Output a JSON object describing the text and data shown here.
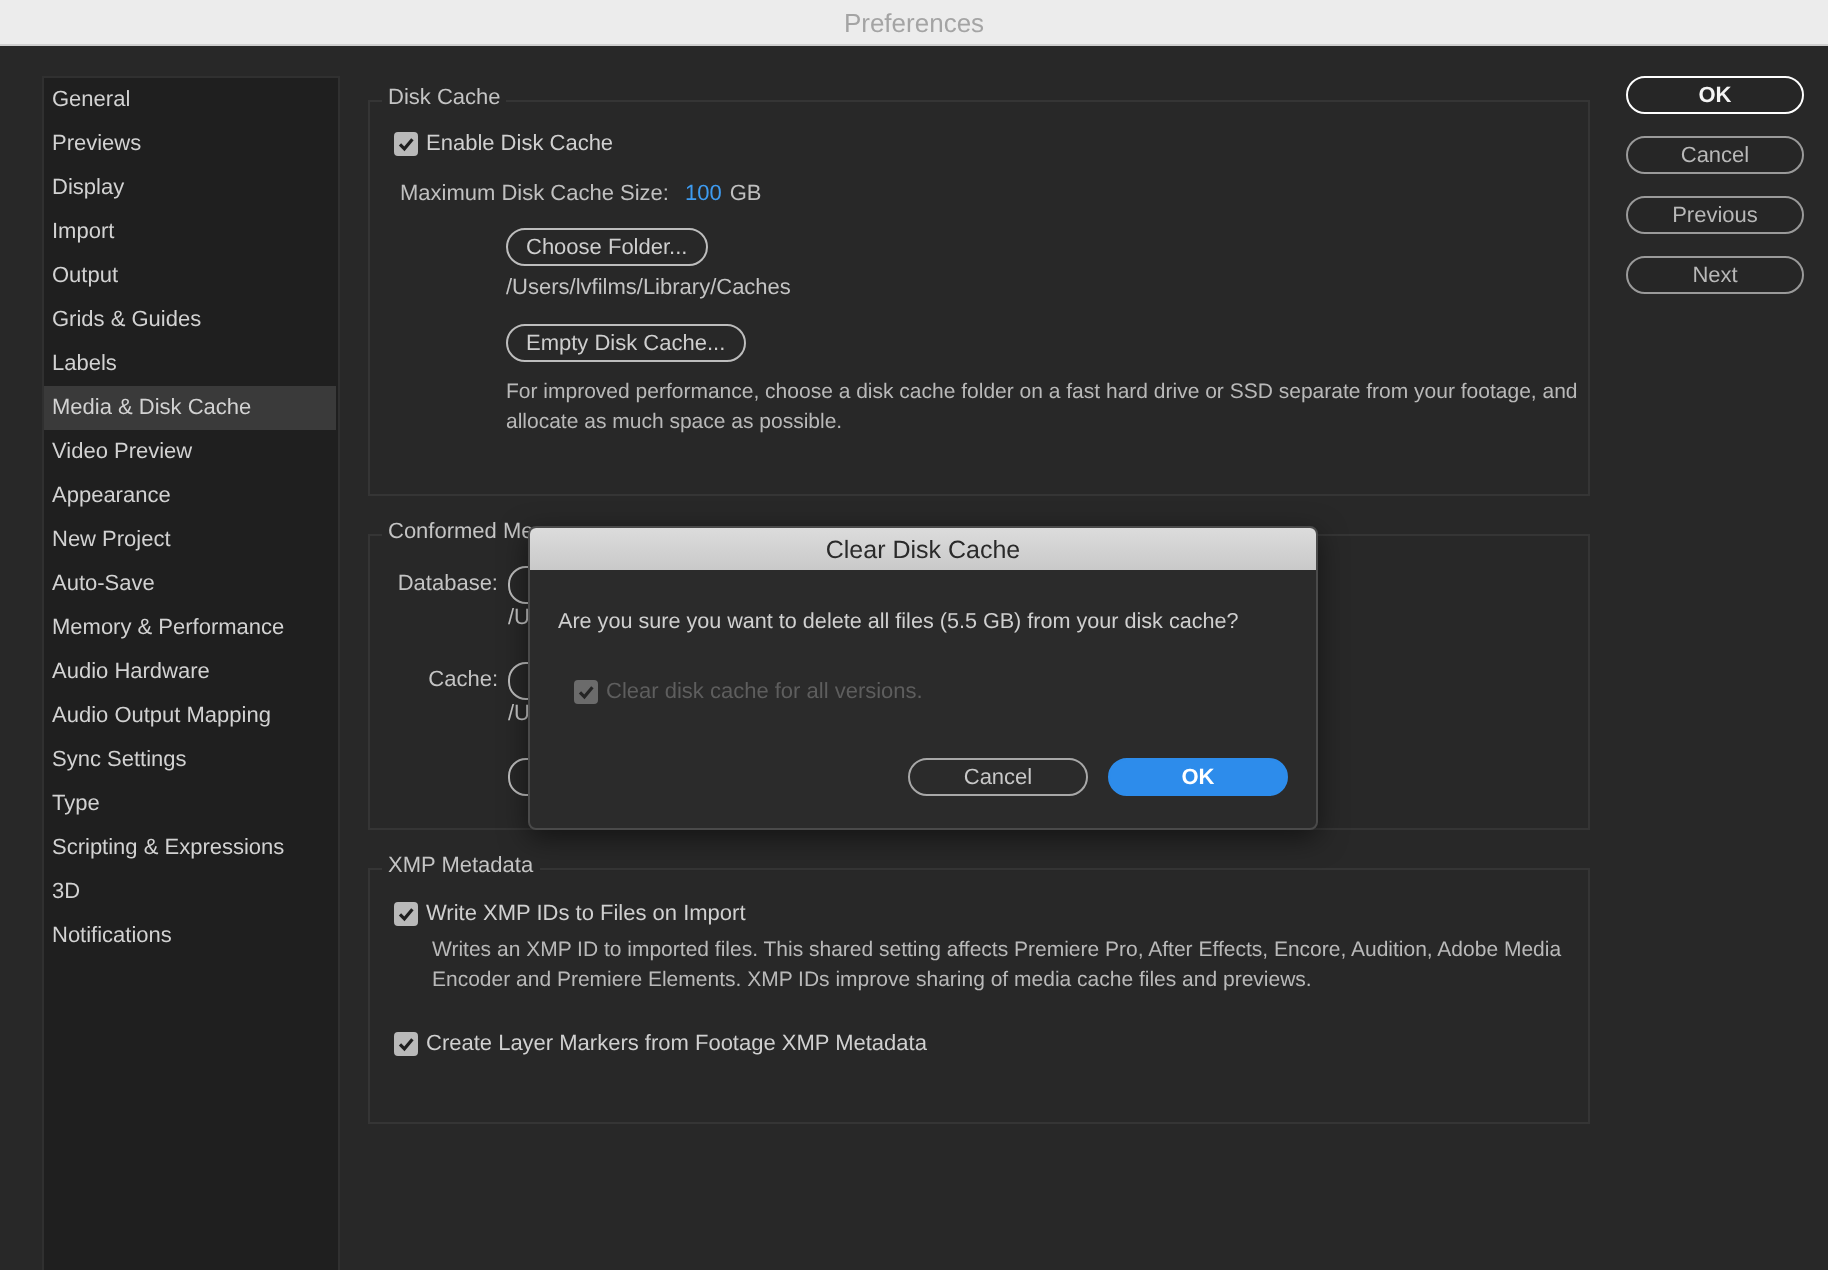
{
  "window": {
    "title": "Preferences"
  },
  "sidebar": {
    "items": [
      {
        "label": "General",
        "selected": false
      },
      {
        "label": "Previews",
        "selected": false
      },
      {
        "label": "Display",
        "selected": false
      },
      {
        "label": "Import",
        "selected": false
      },
      {
        "label": "Output",
        "selected": false
      },
      {
        "label": "Grids & Guides",
        "selected": false
      },
      {
        "label": "Labels",
        "selected": false
      },
      {
        "label": "Media & Disk Cache",
        "selected": true
      },
      {
        "label": "Video Preview",
        "selected": false
      },
      {
        "label": "Appearance",
        "selected": false
      },
      {
        "label": "New Project",
        "selected": false
      },
      {
        "label": "Auto-Save",
        "selected": false
      },
      {
        "label": "Memory & Performance",
        "selected": false
      },
      {
        "label": "Audio Hardware",
        "selected": false
      },
      {
        "label": "Audio Output Mapping",
        "selected": false
      },
      {
        "label": "Sync Settings",
        "selected": false
      },
      {
        "label": "Type",
        "selected": false
      },
      {
        "label": "Scripting & Expressions",
        "selected": false
      },
      {
        "label": "3D",
        "selected": false
      },
      {
        "label": "Notifications",
        "selected": false
      }
    ]
  },
  "disk_cache": {
    "title": "Disk Cache",
    "enable": {
      "label": "Enable Disk Cache",
      "checked": true
    },
    "size_label": "Maximum Disk Cache Size:",
    "size_value": "100",
    "size_unit": "GB",
    "choose_button": "Choose Folder...",
    "path": "/Users/lvfilms/Library/Caches",
    "empty_button": "Empty Disk Cache...",
    "note": "For improved performance, choose a disk cache folder on a fast hard drive or SSD separate from your footage, and allocate as much space as possible."
  },
  "conformed": {
    "title": "Conformed Me",
    "database_label": "Database:",
    "database_path": "/U",
    "cache_label": "Cache:",
    "cache_path": "/U"
  },
  "xmp": {
    "title": "XMP Metadata",
    "options": [
      {
        "label": "Write XMP IDs to Files on Import",
        "checked": true,
        "note": "Writes an XMP ID to imported files. This shared setting affects Premiere Pro, After Effects, Encore, Audition, Adobe Media Encoder and Premiere Elements. XMP IDs improve sharing of media cache files and previews."
      },
      {
        "label": "Create Layer Markers from Footage XMP Metadata",
        "checked": true
      }
    ]
  },
  "buttons": [
    {
      "label": "OK",
      "kind": "default"
    },
    {
      "label": "Cancel",
      "kind": "normal"
    },
    {
      "label": "Previous",
      "kind": "normal"
    },
    {
      "label": "Next",
      "kind": "normal"
    }
  ],
  "dialog": {
    "title": "Clear Disk Cache",
    "message": "Are you sure you want to delete all files (5.5 GB) from your disk cache?",
    "option": {
      "label": "Clear disk cache for all versions.",
      "checked": true,
      "disabled": true
    },
    "buttons": [
      {
        "label": "Cancel",
        "kind": "normal"
      },
      {
        "label": "OK",
        "kind": "primary"
      }
    ]
  }
}
